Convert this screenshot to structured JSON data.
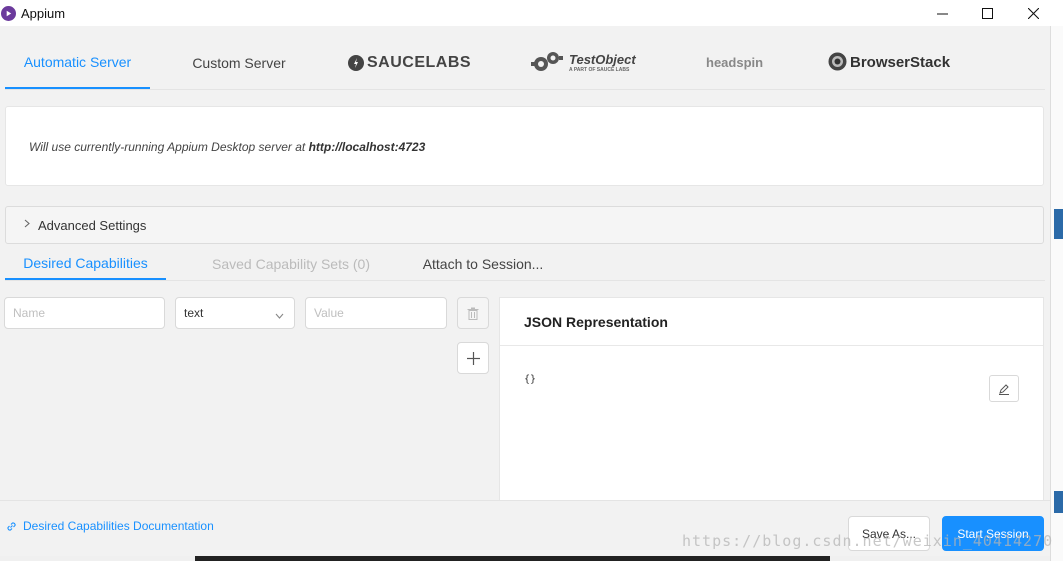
{
  "window": {
    "title": "Appium"
  },
  "server_tabs": {
    "automatic": "Automatic Server",
    "custom": "Custom Server",
    "saucelabs": "SAUCELABS",
    "testobject": "TestObject",
    "testobject_sub": "A PART OF SAUCE LABS",
    "headspin": "headspin",
    "browserstack": "BrowserStack"
  },
  "server_panel": {
    "message": "Will use currently-running Appium Desktop server at",
    "url": "http://localhost:4723"
  },
  "advanced": {
    "label": "Advanced Settings"
  },
  "cap_tabs": {
    "desired": "Desired Capabilities",
    "saved": "Saved Capability Sets (0)",
    "attach": "Attach to Session..."
  },
  "capability_row": {
    "name_placeholder": "Name",
    "type_value": "text",
    "value_placeholder": "Value"
  },
  "json_panel": {
    "title": "JSON Representation",
    "content": "{}"
  },
  "footer": {
    "docs_link": "Desired Capabilities Documentation",
    "save_as": "Save As...",
    "start_session": "Start Session"
  },
  "watermark": "https://blog.csdn.net/weixin_40414270",
  "colors": {
    "accent": "#1890ff",
    "app_icon": "#6b3a9c"
  }
}
